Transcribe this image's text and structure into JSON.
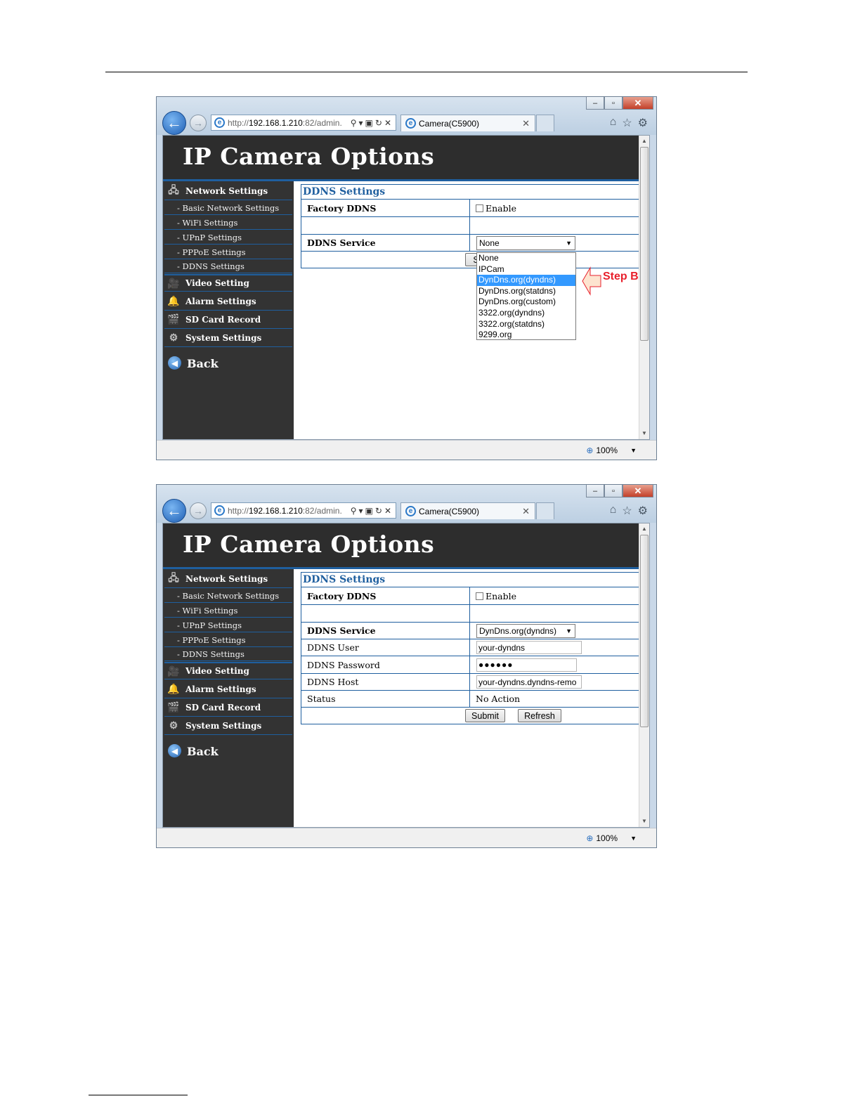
{
  "url": "http://192.168.1.210:82/admin.",
  "url_scheme": "http://",
  "url_host": "192.168.1.210",
  "url_rest": ":82/admin.",
  "tab_title": "Camera(C5900)",
  "zoom_level": "100%",
  "page_header": "IP Camera Options",
  "sidebar": {
    "network": "Network Settings",
    "basic_network": "- Basic Network Settings",
    "wifi": "- WiFi Settings",
    "upnp": "- UPnP Settings",
    "pppoe": "- PPPoE Settings",
    "ddns": "- DDNS Settings",
    "video": "Video Setting",
    "alarm": "Alarm Settings",
    "sdcard": "SD Card Record",
    "system": "System Settings",
    "back": "Back"
  },
  "ddns": {
    "section_title": "DDNS Settings",
    "factory_label": "Factory DDNS",
    "enable_label": "Enable",
    "service_label": "DDNS Service",
    "user_label": "DDNS User",
    "password_label": "DDNS Password",
    "host_label": "DDNS Host",
    "status_label": "Status"
  },
  "screen1": {
    "service_value": "None",
    "submit_partial": "S",
    "dropdown_options": [
      "None",
      "IPCam",
      "DynDns.org(dyndns)",
      "DynDns.org(statdns)",
      "DynDns.org(custom)",
      "3322.org(dyndns)",
      "3322.org(statdns)",
      "9299.org"
    ],
    "selected_option": "DynDns.org(dyndns)",
    "callout": "Step B"
  },
  "screen2": {
    "service_value": "DynDns.org(dyndns)",
    "user_value": "your-dyndns",
    "password_value": "●●●●●●",
    "host_value": "your-dyndns.dyndns-remo",
    "status_value": "No Action",
    "submit_label": "Submit",
    "refresh_label": "Refresh"
  },
  "colors": {
    "accent_blue": "#1f5f9f",
    "sidebar_bg": "#333333",
    "header_bg": "#2d2d2d",
    "selection": "#3399ff",
    "callout_red": "#e8202c"
  }
}
